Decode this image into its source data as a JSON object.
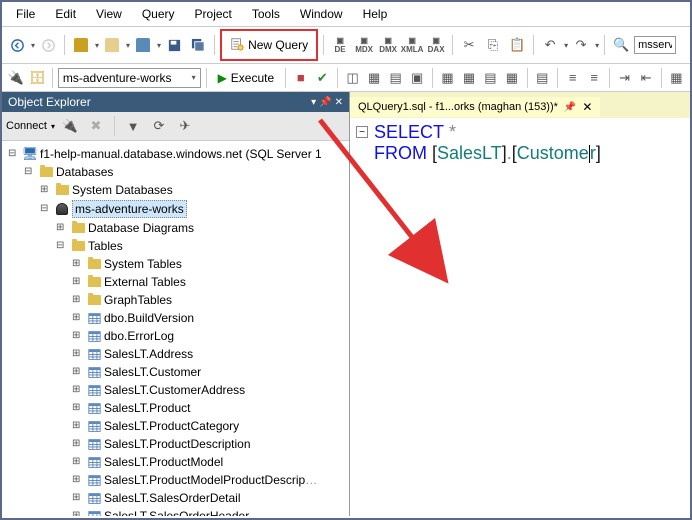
{
  "menu": [
    "File",
    "Edit",
    "View",
    "Query",
    "Project",
    "Tools",
    "Window",
    "Help"
  ],
  "toolbar1": {
    "newquery_label": "New Query",
    "search_value": "msservi"
  },
  "toolbar2": {
    "db_selected": "ms-adventure-works",
    "execute_label": "Execute"
  },
  "explorer": {
    "title": "Object Explorer",
    "connect_label": "Connect",
    "server": "f1-help-manual.database.windows.net (SQL Server 1",
    "databases": "Databases",
    "sysdb": "System Databases",
    "userdb": "ms-adventure-works",
    "diagrams": "Database Diagrams",
    "tables_label": "Tables",
    "sys_tables": "System Tables",
    "ext_tables": "External Tables",
    "graph_tables": "GraphTables",
    "tables": [
      "dbo.BuildVersion",
      "dbo.ErrorLog",
      "SalesLT.Address",
      "SalesLT.Customer",
      "SalesLT.CustomerAddress",
      "SalesLT.Product",
      "SalesLT.ProductCategory",
      "SalesLT.ProductDescription",
      "SalesLT.ProductModel",
      "SalesLT.ProductModelProductDescrip",
      "SalesLT.SalesOrderDetail",
      "SalesLT.SalesOrderHeader"
    ]
  },
  "editor": {
    "tab_label": "QLQuery1.sql - f1...orks (maghan (153))*",
    "code": {
      "select": "SELECT",
      "star": "*",
      "from": "FROM",
      "b1": "[",
      "schema": "SalesLT",
      "b2": "]",
      "dot": ".",
      "b3": "[",
      "obj_part1": "Custome",
      "obj_part2": "r",
      "b4": "]"
    }
  }
}
